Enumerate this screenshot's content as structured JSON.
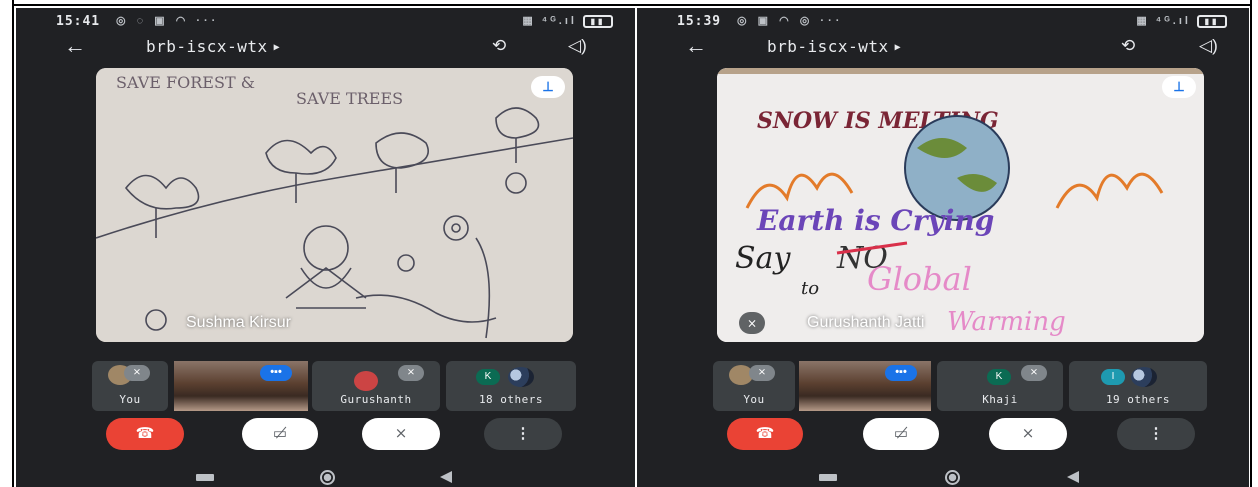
{
  "phones": [
    {
      "status_time": "15:41",
      "meeting_code": "brb-iscx-wtx",
      "main_tile": {
        "name": "Sushma Kirsur",
        "drawing_text": [
          "SAVE FOREST &",
          "SAVE TREES"
        ]
      },
      "tiles": [
        {
          "label": "You"
        },
        {
          "label": ""
        },
        {
          "label": "Gurushanth"
        },
        {
          "label": "18 others",
          "avatar_letter": "K"
        }
      ]
    },
    {
      "status_time": "15:39",
      "meeting_code": "brb-iscx-wtx",
      "main_tile": {
        "name": "Gurushanth Jatti",
        "drawing_text": [
          "SNOW IS MELTING",
          "Earth is Crying",
          "Say",
          "NO",
          "to",
          "Global",
          "Warming"
        ]
      },
      "tiles": [
        {
          "label": "You"
        },
        {
          "label": ""
        },
        {
          "label": "Khaji",
          "avatar_letter": "K"
        },
        {
          "label": "19 others",
          "avatar_letter": "I"
        }
      ]
    }
  ],
  "icons": {
    "back": "arrow-left-icon",
    "flip": "camera-flip-icon",
    "speaker": "speaker-icon",
    "pin": "pin-icon",
    "end": "end-call-icon",
    "camera_off": "camera-off-icon",
    "mic_off": "mic-off-icon",
    "more": "more-vert-icon"
  },
  "colors": {
    "background": "#202124",
    "end_call": "#ea4335",
    "accent": "#1a73e8"
  }
}
